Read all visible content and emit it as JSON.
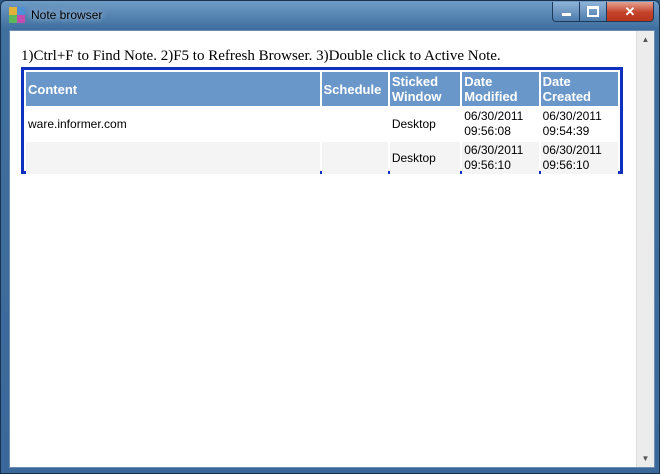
{
  "window": {
    "title": "Note browser",
    "icon": "note-browser-app-icon",
    "minimize_label": "▬",
    "maximize_label": "□",
    "close_label": "✕"
  },
  "hint_text": "1)Ctrl+F to Find Note. 2)F5 to Refresh Browser. 3)Double click to Active Note.",
  "table": {
    "columns": [
      "Content",
      "Schedule",
      "Sticked Window",
      "Date Modified",
      "Date Created"
    ],
    "rows": [
      {
        "content": "ware.informer.com",
        "schedule": "",
        "window": "Desktop",
        "modified_date": "06/30/2011",
        "modified_time": "09:56:08",
        "created_date": "06/30/2011",
        "created_time": "09:54:39"
      },
      {
        "content": "",
        "schedule": "",
        "window": "Desktop",
        "modified_date": "06/30/2011",
        "modified_time": "09:56:10",
        "created_date": "06/30/2011",
        "created_time": "09:56:10"
      }
    ]
  },
  "colors": {
    "header_bg": "#6a97c9",
    "table_border": "#0f2fbf",
    "title_bar": "#4a7aab"
  }
}
